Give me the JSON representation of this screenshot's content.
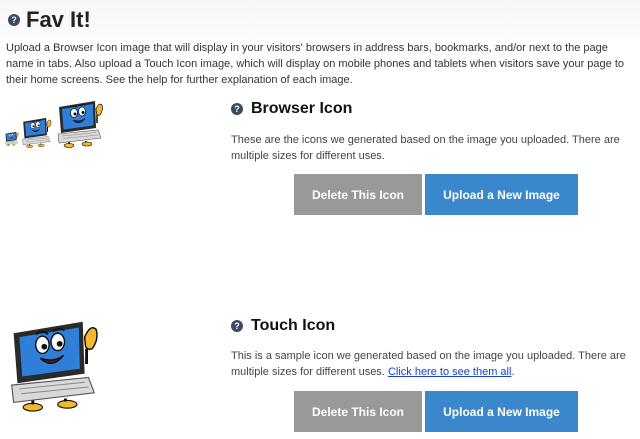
{
  "page": {
    "title": "Fav It!",
    "intro": "Upload a Browser Icon image that will display in your visitors' browsers in address bars, bookmarks, and/or next to the page name in tabs. Also upload a Touch Icon image, which will display on mobile phones and tablets when visitors save your page to their home screens. See the help for further explanation of each image."
  },
  "help_glyph": "?",
  "browser": {
    "heading": "Browser Icon",
    "description": "These are the icons we generated based on the image you uploaded. There are multiple sizes for different uses.",
    "delete_label": "Delete This Icon",
    "upload_label": "Upload a New Image"
  },
  "touch": {
    "heading": "Touch Icon",
    "description": "This is a sample icon we generated based on the image you uploaded. There are multiple sizes for different uses.",
    "link_text": "Click here to see them all",
    "link_suffix": ".",
    "delete_label": "Delete This Icon",
    "upload_label": "Upload a New Image"
  },
  "icons": {
    "help": "help-question-icon",
    "mascot": "computer-mascot-icon"
  },
  "colors": {
    "delete_button": "#999999",
    "upload_button": "#3a87cc",
    "link": "#1a40d4",
    "help_badge": "#3d4a66"
  }
}
